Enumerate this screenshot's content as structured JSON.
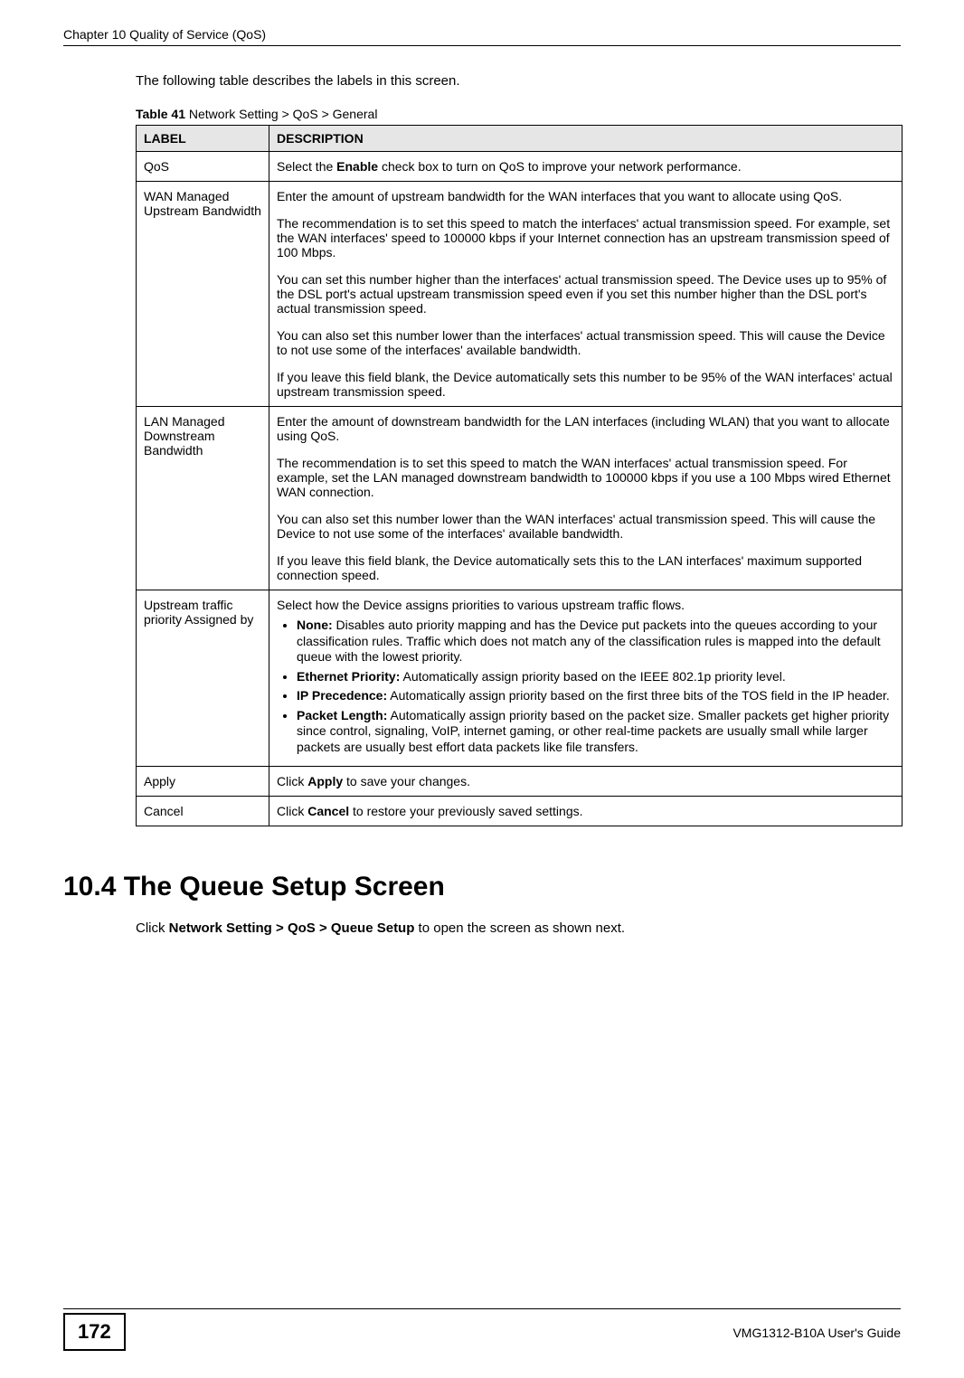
{
  "header": {
    "chapter": "Chapter 10 Quality of Service (QoS)"
  },
  "intro": "The following table describes the labels in this screen.",
  "table": {
    "caption_prefix": "Table 41",
    "caption_rest": "   Network Setting > QoS > General",
    "col_label": "LABEL",
    "col_desc": "DESCRIPTION",
    "rows": {
      "qos": {
        "label": "QoS",
        "p1a": "Select the ",
        "p1b": "Enable",
        "p1c": " check box to turn on QoS to improve your network performance."
      },
      "wan": {
        "label": "WAN Managed Upstream Bandwidth",
        "p1": "Enter the amount of upstream bandwidth for the WAN interfaces that you want to allocate using QoS.",
        "p2": "The recommendation is to set this speed to match the interfaces' actual transmission speed. For example, set the WAN interfaces' speed to 100000 kbps if your Internet connection has an upstream transmission speed of 100 Mbps.",
        "p3": "You can set this number higher than the interfaces' actual transmission speed. The Device uses up to 95% of the DSL port's actual upstream transmission speed even if you set this number higher than the DSL port's actual transmission speed.",
        "p4": "You can also set this number lower than the interfaces' actual transmission speed. This will cause the Device to not use some of the interfaces' available bandwidth.",
        "p5": "If you leave this field blank, the Device automatically sets this number to be 95% of the WAN interfaces' actual upstream transmission speed."
      },
      "lan": {
        "label": "LAN Managed Downstream Bandwidth",
        "p1": "Enter the amount of downstream bandwidth for the LAN interfaces (including WLAN) that you want to allocate using QoS.",
        "p2": "The recommendation is to set this speed to match the WAN interfaces' actual transmission speed. For example, set the LAN managed downstream bandwidth to 100000 kbps if you use a 100 Mbps wired Ethernet WAN connection.",
        "p3": "You can also set this number lower than the WAN interfaces' actual transmission speed. This will cause the Device to not use some of the interfaces' available bandwidth.",
        "p4": "If you leave this field blank, the Device automatically sets this to the LAN interfaces' maximum supported connection speed."
      },
      "upstream": {
        "label": "Upstream traffic priority Assigned by",
        "p1": "Select how the Device assigns priorities to various upstream traffic flows.",
        "b1_bold": "None:",
        "b1_rest": " Disables auto priority mapping and has the Device put packets into the queues according to your classification rules. Traffic which does not match any of the classification rules is mapped into the default queue with the lowest priority.",
        "b2_bold": "Ethernet Priority:",
        "b2_rest": " Automatically assign priority based on the IEEE 802.1p priority level.",
        "b3_bold": "IP Precedence:",
        "b3_rest": " Automatically assign priority based on the first three bits of the TOS field in the IP header.",
        "b4_bold": "Packet Length:",
        "b4_rest": " Automatically assign priority based on the packet size. Smaller packets get higher priority since control, signaling, VoIP, internet gaming, or other real-time packets are usually small while larger packets are usually best effort data packets like file transfers."
      },
      "apply": {
        "label": "Apply",
        "p1a": "Click ",
        "p1b": "Apply",
        "p1c": " to save your changes."
      },
      "cancel": {
        "label": "Cancel",
        "p1a": "Click ",
        "p1b": "Cancel",
        "p1c": " to restore your previously saved settings."
      }
    }
  },
  "section": {
    "heading": "10.4  The Queue Setup Screen",
    "body_a": "Click ",
    "body_b": "Network Setting > QoS > Queue Setup",
    "body_c": " to open the screen as shown next."
  },
  "footer": {
    "page": "172",
    "guide": "VMG1312-B10A User's Guide"
  }
}
